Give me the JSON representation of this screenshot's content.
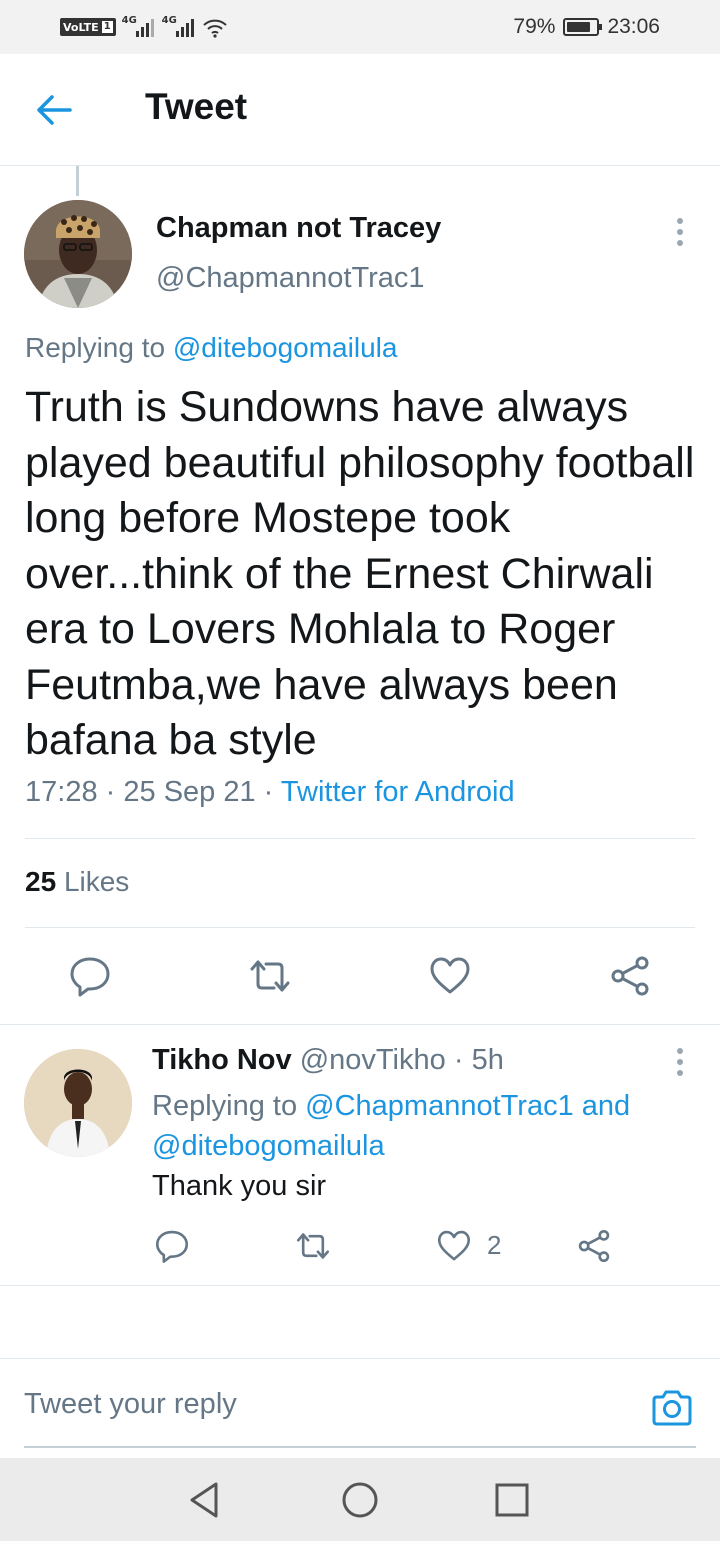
{
  "status_bar": {
    "volte": "VoLTE",
    "sim": "1",
    "network1": "4G",
    "network2": "4G",
    "battery": "79%",
    "battery_level": 0.79,
    "time": "23:06"
  },
  "header": {
    "title": "Tweet"
  },
  "tweet": {
    "author_name": "Chapman not Tracey",
    "author_handle": "@ChapmannotTrac1",
    "replying_prefix": "Replying to",
    "replying_to": "@ditebogomailula",
    "text": "Truth is Sundowns have always played beautiful philosophy football long before Mostepe took over...think of the Ernest Chirwali era to Lovers Mohlala to Roger Feutmba,we have always been bafana ba style",
    "time": "17:28",
    "date": "25 Sep 21",
    "source": "Twitter for Android",
    "likes_count": "25",
    "likes_label": "Likes"
  },
  "reply": {
    "name": "Tikho Nov",
    "handle": "@novTikho",
    "age": "5h",
    "replying_prefix": "Replying to",
    "replying_to_1": "@ChapmannotTrac1",
    "replying_and": "and",
    "replying_to_2": "@ditebogomailula",
    "text": "Thank you sir",
    "likes": "2"
  },
  "compose": {
    "placeholder": "Tweet your reply"
  },
  "colors": {
    "accent": "#1b95e0",
    "text": "#14171a",
    "muted": "#657786",
    "divider": "#e1e8ed"
  }
}
